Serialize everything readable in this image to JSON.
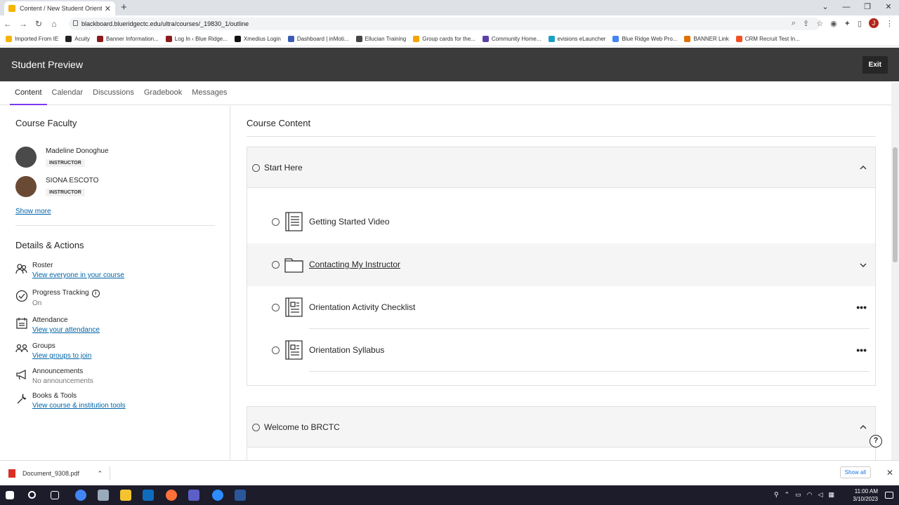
{
  "browser": {
    "tab_title": "Content / New Student Orientatio",
    "url": "blackboard.blueridgectc.edu/ultra/courses/_19830_1/outline",
    "bookmarks": [
      {
        "label": "Imported From IE",
        "color": "#f4b400"
      },
      {
        "label": "Acuity",
        "color": "#222222"
      },
      {
        "label": "Banner Information...",
        "color": "#8b1a1a"
      },
      {
        "label": "Log In ‹ Blue Ridge...",
        "color": "#8b1a1a"
      },
      {
        "label": "Xmedius Login",
        "color": "#111111"
      },
      {
        "label": "Dashboard | inMoti...",
        "color": "#3b5bb5"
      },
      {
        "label": "Ellucian Training",
        "color": "#444444"
      },
      {
        "label": "Group cards for the...",
        "color": "#f4a300"
      },
      {
        "label": "Community Home...",
        "color": "#5b3fa8"
      },
      {
        "label": "evisions eLauncher",
        "color": "#1aa0c8"
      },
      {
        "label": "Blue Ridge Web Pro...",
        "color": "#4285f4"
      },
      {
        "label": "BANNER Link",
        "color": "#e07000"
      },
      {
        "label": "CRM Recruit Test In...",
        "color": "#f25022"
      }
    ],
    "profile_initial": "J"
  },
  "preview": {
    "title": "Student Preview",
    "exit_label": "Exit"
  },
  "course_nav": [
    "Content",
    "Calendar",
    "Discussions",
    "Gradebook",
    "Messages"
  ],
  "faculty": {
    "title": "Course Faculty",
    "members": [
      {
        "name": "Madeline Donoghue",
        "role": "INSTRUCTOR"
      },
      {
        "name": "SIONA ESCOTO",
        "role": "INSTRUCTOR"
      }
    ],
    "show_more": "Show more"
  },
  "details": {
    "title": "Details & Actions",
    "roster": {
      "label": "Roster",
      "sub": "View everyone in your course"
    },
    "progress": {
      "label": "Progress Tracking",
      "sub": "On"
    },
    "attendance": {
      "label": "Attendance",
      "sub": "View your attendance"
    },
    "groups": {
      "label": "Groups",
      "sub": "View groups to join"
    },
    "announcements": {
      "label": "Announcements",
      "sub": "No announcements"
    },
    "books": {
      "label": "Books & Tools",
      "sub": "View course & institution tools"
    }
  },
  "content": {
    "title": "Course Content",
    "folders": [
      {
        "title": "Start Here",
        "items": [
          {
            "title": "Getting Started Video"
          },
          {
            "title": "Contacting My Instructor"
          },
          {
            "title": "Orientation Activity Checklist"
          },
          {
            "title": "Orientation Syllabus"
          }
        ]
      },
      {
        "title": "Welcome to BRCTC"
      }
    ]
  },
  "download": {
    "filename": "Document_9308.pdf",
    "show_all": "Show all"
  },
  "taskbar": {
    "time": "11:00 AM",
    "date": "3/10/2023"
  }
}
